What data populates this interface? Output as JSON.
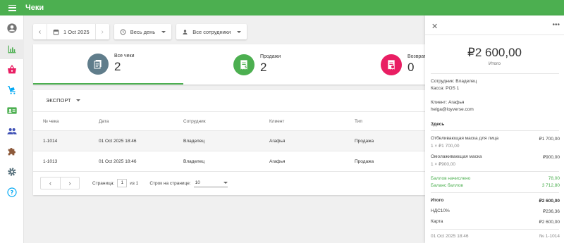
{
  "app": {
    "title": "Чеки"
  },
  "sidebar": {
    "items": [
      {
        "icon": "account-icon"
      },
      {
        "icon": "bar-chart-icon",
        "active": true
      },
      {
        "icon": "basket-icon"
      },
      {
        "icon": "cart-tag-icon"
      },
      {
        "icon": "id-card-icon"
      },
      {
        "icon": "people-icon"
      },
      {
        "icon": "puzzle-icon"
      },
      {
        "icon": "gear-icon"
      },
      {
        "icon": "help-icon"
      }
    ]
  },
  "toolbar": {
    "date": "1 Oct 2025",
    "period": "Весь день",
    "employees": "Все сотрудники"
  },
  "summary": {
    "all": {
      "label": "Все чеки",
      "value": "2",
      "color": "#607d8b"
    },
    "sales": {
      "label": "Продажи",
      "value": "2",
      "color": "#4caf50"
    },
    "refunds": {
      "label": "Возвраты",
      "value": "0",
      "color": "#e91e63"
    }
  },
  "table": {
    "export_label": "ЭКСПОРТ",
    "columns": [
      "№ чека",
      "Дата",
      "Сотрудник",
      "Клиент",
      "Тип"
    ],
    "rows": [
      [
        "1-1014",
        "01 Oct 2025 18:46",
        "Владелец",
        "Агафья",
        "Продажа"
      ],
      [
        "1-1013",
        "01 Oct 2025 18:46",
        "Владелец",
        "Агафья",
        "Продажа"
      ]
    ],
    "pager": {
      "page_label": "Страница:",
      "page": "1",
      "of_label": "из 1",
      "rows_label": "Строк на странице:",
      "rows_value": "10"
    }
  },
  "receipt": {
    "total": "₽2 600,00",
    "total_label": "Итого",
    "employee": "Сотрудник: Владелец",
    "register": "Касса: POS 1",
    "client": "Клиент: Агафья",
    "email": "helga@loyverse.com",
    "dining": "Здесь",
    "items": [
      {
        "name": "Отбеливающая маска для лица",
        "detail": "1 × ₽1 700,00",
        "price": "₽1 700,00"
      },
      {
        "name": "Омолаживающая маска",
        "detail": "1 × ₽900,00",
        "price": "₽900,00"
      }
    ],
    "points_earned_label": "Баллов начислено",
    "points_earned": "78,00",
    "points_balance_label": "Баланс баллов",
    "points_balance": "3 712,80",
    "sum_label": "Итого",
    "sum_value": "₽2 600,00",
    "tax_label": "НДС10%",
    "tax_value": "₽236,36",
    "pay_label": "Карта",
    "pay_value": "₽2 600,00",
    "footer_date": "01 Oct 2025 18:46",
    "footer_number": "№ 1-1014"
  }
}
